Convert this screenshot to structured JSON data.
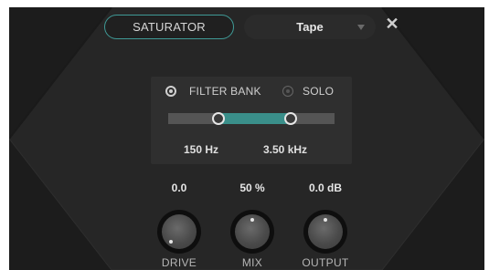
{
  "header": {
    "module_button": "SATURATOR",
    "preset": {
      "selected": "Tape"
    },
    "close_label": "✕"
  },
  "filter": {
    "filter_bank_label": "FILTER BANK",
    "filter_bank_selected": true,
    "solo_label": "SOLO",
    "solo_selected": false,
    "low_freq": "150 Hz",
    "high_freq": "3.50 kHz"
  },
  "knobs": [
    {
      "label": "DRIVE",
      "value": "0.0"
    },
    {
      "label": "MIX",
      "value": "50 %"
    },
    {
      "label": "OUTPUT",
      "value": "0.0 dB"
    }
  ],
  "colors": {
    "accent": "#3a8f8a",
    "panel": "#1c1c1c",
    "section": "#2f2f2f"
  }
}
